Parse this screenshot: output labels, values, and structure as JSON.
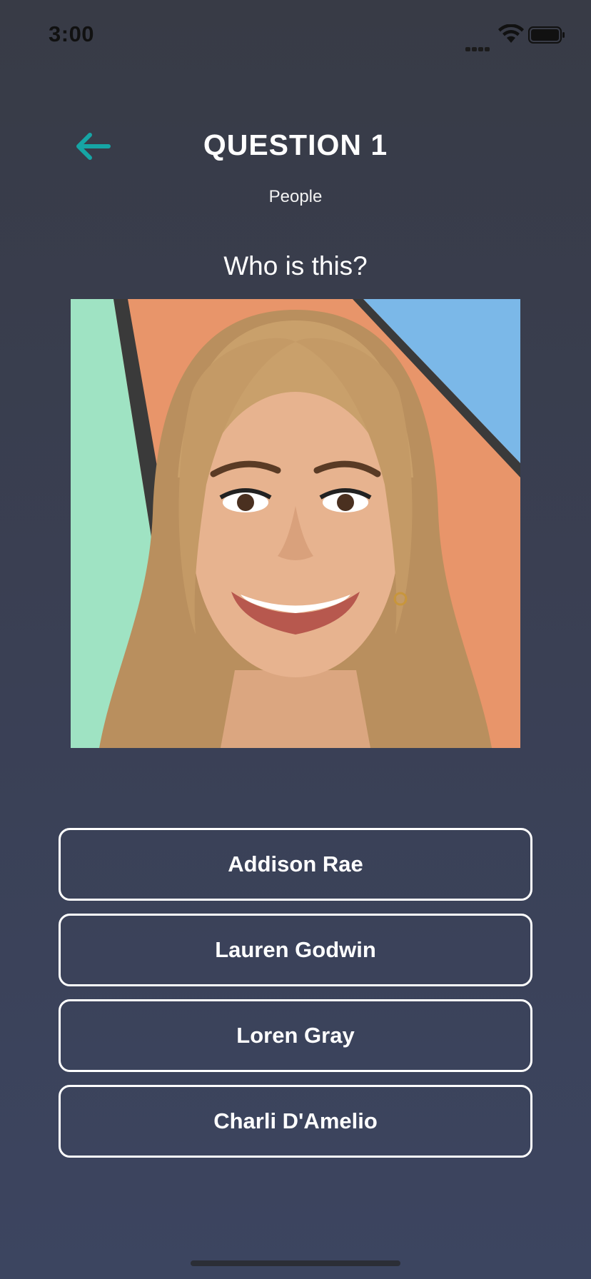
{
  "status_bar": {
    "time": "3:00",
    "icons": [
      "signal-icon",
      "wifi-icon",
      "battery-icon"
    ]
  },
  "header": {
    "back_icon": "arrow-left-icon",
    "title": "QUESTION 1",
    "category": "People"
  },
  "question": {
    "prompt": "Who is this?"
  },
  "answers": [
    {
      "label": "Addison Rae"
    },
    {
      "label": "Lauren Godwin"
    },
    {
      "label": "Loren Gray"
    },
    {
      "label": "Charli D'Amelio"
    }
  ],
  "colors": {
    "accent": "#16a5a5",
    "background_top": "#383b46",
    "background_bottom": "#3c4560",
    "button_border": "#ffffff"
  }
}
